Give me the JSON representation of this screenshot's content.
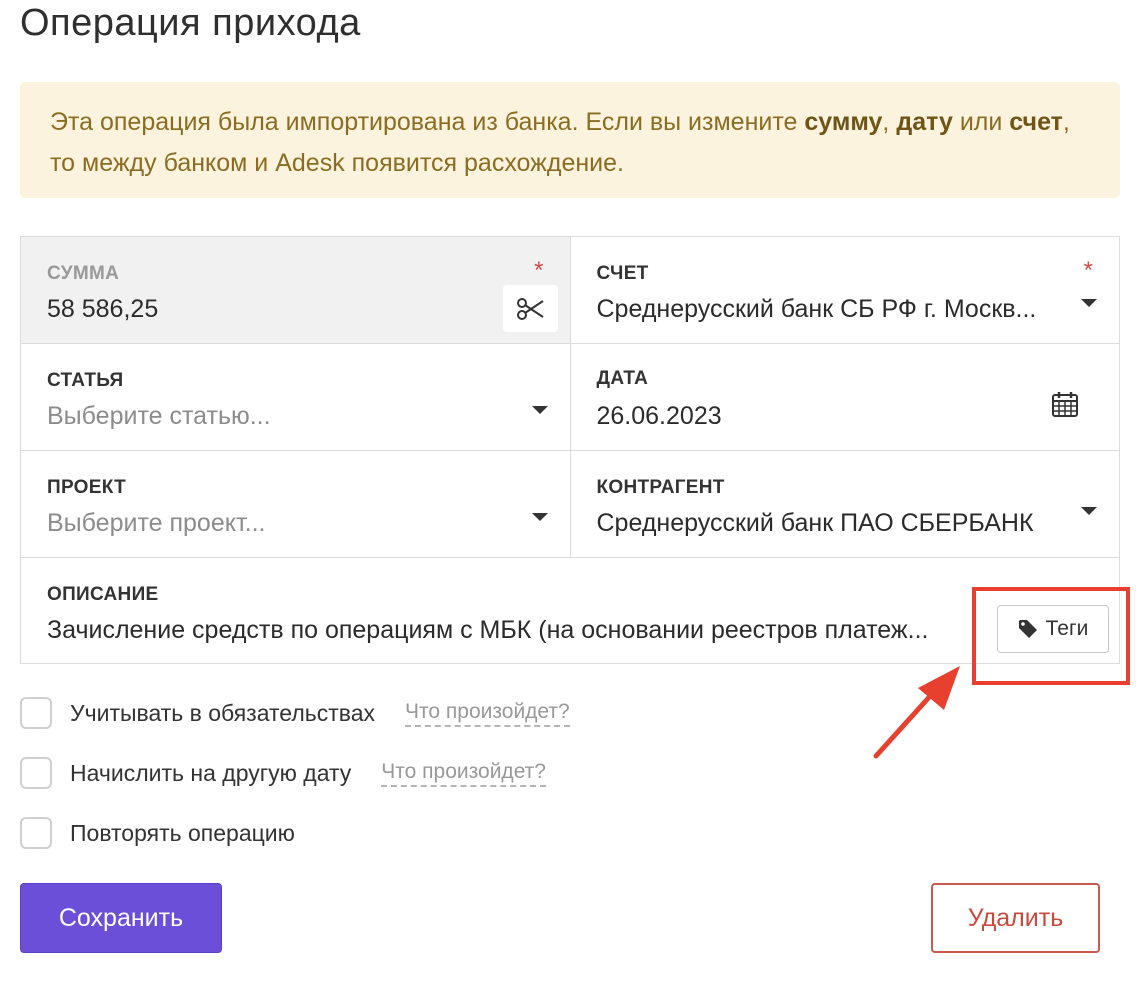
{
  "page": {
    "title": "Операция прихода"
  },
  "alert": {
    "text_1": "Эта операция была импортирована из банка. Если вы измените ",
    "bold_1": "сумму",
    "text_2": ", ",
    "bold_2": "дату",
    "text_3": " или ",
    "bold_3": "счет",
    "text_4": ", то между банком и Adesk появится расхождение."
  },
  "fields": {
    "amount": {
      "label": "СУММА",
      "value": "58 586,25",
      "required": "*"
    },
    "account": {
      "label": "СЧЕТ",
      "value": "Среднерусский банк СБ РФ г. Москв...",
      "required": "*"
    },
    "category": {
      "label": "СТАТЬЯ",
      "placeholder": "Выберите статью..."
    },
    "date": {
      "label": "ДАТА",
      "value": "26.06.2023"
    },
    "project": {
      "label": "ПРОЕКТ",
      "placeholder": "Выберите проект..."
    },
    "counterparty": {
      "label": "КОНТРАГЕНТ",
      "value": "Среднерусский банк ПАО СБЕРБАНК"
    },
    "description": {
      "label": "ОПИСАНИЕ",
      "value": "Зачисление средств по операциям с МБК (на основании реестров платеж..."
    }
  },
  "tags_button": {
    "label": "Теги",
    "icon": "tag-icon"
  },
  "options": {
    "obligations": {
      "label": "Учитывать в обязательствах",
      "help": "Что произойдет?",
      "checked": false
    },
    "other_date": {
      "label": "Начислить на другую дату",
      "help": "Что произойдет?",
      "checked": false
    },
    "repeat": {
      "label": "Повторять операцию",
      "checked": false
    }
  },
  "actions": {
    "save_label": "Сохранить",
    "delete_label": "Удалить"
  },
  "colors": {
    "primary": "#6b4fd8",
    "danger": "#c94a3d",
    "alert_bg": "#fbf3dd",
    "alert_text": "#8a6d22",
    "annotation": "#e8402f"
  }
}
